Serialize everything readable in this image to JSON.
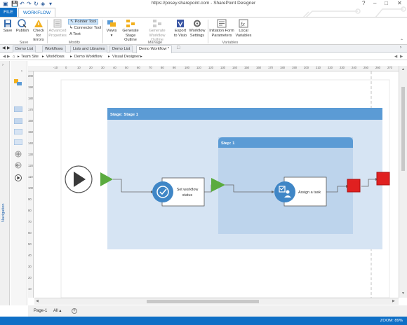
{
  "window": {
    "title": "https://posey.sharepoint.com - SharePoint Designer",
    "help": "?",
    "minimize": "–",
    "maximize": "□",
    "close": "✕"
  },
  "ribbon": {
    "tabs": [
      "FILE",
      "WORKFLOW"
    ],
    "active_tab": "WORKFLOW",
    "groups": {
      "save": {
        "label": "Save",
        "buttons": {
          "save": "Save",
          "publish": "Publish",
          "check_line1": "Check",
          "check_line2": "for Errors"
        }
      },
      "modify": {
        "label": "Modify",
        "advanced_line1": "Advanced",
        "advanced_line2": "Properties",
        "pointer_tool": "Pointer Tool",
        "connector_tool": "Connector Tool",
        "text_tool": "Text"
      },
      "manage": {
        "label": "Manage",
        "views": "Views",
        "generate_stage_line1": "Generate",
        "generate_stage_line2": "Stage Outline",
        "generate_workflow_line1": "Generate",
        "generate_workflow_line2": "Workflow Outline",
        "export_line1": "Export",
        "export_line2": "to Visio",
        "settings_line1": "Workflow",
        "settings_line2": "Settings"
      },
      "variables": {
        "label": "Variables",
        "init_line1": "Initiation Form",
        "init_line2": "Parameters",
        "local_line1": "Local",
        "local_line2": "Variables"
      }
    }
  },
  "doc_tabs": [
    "Demo List",
    "Workflows",
    "Lists and Libraries",
    "Demo List",
    "Demo Workflow *"
  ],
  "breadcrumb": [
    "Team Site",
    "Workflows",
    "Demo Workflow",
    "Visual Designer"
  ],
  "side_nav_label": "Navigation",
  "ruler": {
    "h_ticks": [
      "-10",
      "0",
      "10",
      "20",
      "30",
      "40",
      "50",
      "60",
      "70",
      "80",
      "90",
      "100",
      "110",
      "120",
      "130",
      "140",
      "150",
      "160",
      "170",
      "180",
      "190",
      "200",
      "210",
      "220",
      "230",
      "240",
      "250",
      "260",
      "270",
      "280",
      "290",
      "300"
    ],
    "v_ticks": [
      "200",
      "190",
      "180",
      "170",
      "160",
      "150",
      "140",
      "130",
      "120",
      "110",
      "100",
      "90",
      "80",
      "70",
      "60",
      "50",
      "40",
      "30",
      "20",
      "10",
      "0"
    ]
  },
  "diagram": {
    "stage_title": "Stage:   Stage 1",
    "step_title": "Step:    1",
    "action1_line1": "Set workflow",
    "action1_line2": "status",
    "action2_label": "Assign a task",
    "colors": {
      "stage_fill": "#d6e4f3",
      "stage_header": "#5b9bd5",
      "step_fill": "#bdd4ec",
      "step_header": "#5b9bd5",
      "arrow_green": "#5aab3f",
      "stop_red": "#e02020",
      "action_blue": "#3f86c6"
    }
  },
  "page_tabs": {
    "page": "Page-1",
    "all": "All ▴",
    "add": "+"
  },
  "status": {
    "zoom": "ZOOM: 89%"
  }
}
